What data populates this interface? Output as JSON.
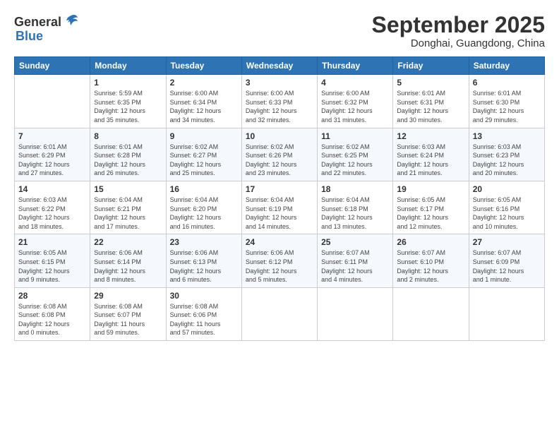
{
  "header": {
    "logo_general": "General",
    "logo_blue": "Blue",
    "month": "September 2025",
    "location": "Donghai, Guangdong, China"
  },
  "weekdays": [
    "Sunday",
    "Monday",
    "Tuesday",
    "Wednesday",
    "Thursday",
    "Friday",
    "Saturday"
  ],
  "weeks": [
    [
      {
        "day": "",
        "info": ""
      },
      {
        "day": "1",
        "info": "Sunrise: 5:59 AM\nSunset: 6:35 PM\nDaylight: 12 hours\nand 35 minutes."
      },
      {
        "day": "2",
        "info": "Sunrise: 6:00 AM\nSunset: 6:34 PM\nDaylight: 12 hours\nand 34 minutes."
      },
      {
        "day": "3",
        "info": "Sunrise: 6:00 AM\nSunset: 6:33 PM\nDaylight: 12 hours\nand 32 minutes."
      },
      {
        "day": "4",
        "info": "Sunrise: 6:00 AM\nSunset: 6:32 PM\nDaylight: 12 hours\nand 31 minutes."
      },
      {
        "day": "5",
        "info": "Sunrise: 6:01 AM\nSunset: 6:31 PM\nDaylight: 12 hours\nand 30 minutes."
      },
      {
        "day": "6",
        "info": "Sunrise: 6:01 AM\nSunset: 6:30 PM\nDaylight: 12 hours\nand 29 minutes."
      }
    ],
    [
      {
        "day": "7",
        "info": "Sunrise: 6:01 AM\nSunset: 6:29 PM\nDaylight: 12 hours\nand 27 minutes."
      },
      {
        "day": "8",
        "info": "Sunrise: 6:01 AM\nSunset: 6:28 PM\nDaylight: 12 hours\nand 26 minutes."
      },
      {
        "day": "9",
        "info": "Sunrise: 6:02 AM\nSunset: 6:27 PM\nDaylight: 12 hours\nand 25 minutes."
      },
      {
        "day": "10",
        "info": "Sunrise: 6:02 AM\nSunset: 6:26 PM\nDaylight: 12 hours\nand 23 minutes."
      },
      {
        "day": "11",
        "info": "Sunrise: 6:02 AM\nSunset: 6:25 PM\nDaylight: 12 hours\nand 22 minutes."
      },
      {
        "day": "12",
        "info": "Sunrise: 6:03 AM\nSunset: 6:24 PM\nDaylight: 12 hours\nand 21 minutes."
      },
      {
        "day": "13",
        "info": "Sunrise: 6:03 AM\nSunset: 6:23 PM\nDaylight: 12 hours\nand 20 minutes."
      }
    ],
    [
      {
        "day": "14",
        "info": "Sunrise: 6:03 AM\nSunset: 6:22 PM\nDaylight: 12 hours\nand 18 minutes."
      },
      {
        "day": "15",
        "info": "Sunrise: 6:04 AM\nSunset: 6:21 PM\nDaylight: 12 hours\nand 17 minutes."
      },
      {
        "day": "16",
        "info": "Sunrise: 6:04 AM\nSunset: 6:20 PM\nDaylight: 12 hours\nand 16 minutes."
      },
      {
        "day": "17",
        "info": "Sunrise: 6:04 AM\nSunset: 6:19 PM\nDaylight: 12 hours\nand 14 minutes."
      },
      {
        "day": "18",
        "info": "Sunrise: 6:04 AM\nSunset: 6:18 PM\nDaylight: 12 hours\nand 13 minutes."
      },
      {
        "day": "19",
        "info": "Sunrise: 6:05 AM\nSunset: 6:17 PM\nDaylight: 12 hours\nand 12 minutes."
      },
      {
        "day": "20",
        "info": "Sunrise: 6:05 AM\nSunset: 6:16 PM\nDaylight: 12 hours\nand 10 minutes."
      }
    ],
    [
      {
        "day": "21",
        "info": "Sunrise: 6:05 AM\nSunset: 6:15 PM\nDaylight: 12 hours\nand 9 minutes."
      },
      {
        "day": "22",
        "info": "Sunrise: 6:06 AM\nSunset: 6:14 PM\nDaylight: 12 hours\nand 8 minutes."
      },
      {
        "day": "23",
        "info": "Sunrise: 6:06 AM\nSunset: 6:13 PM\nDaylight: 12 hours\nand 6 minutes."
      },
      {
        "day": "24",
        "info": "Sunrise: 6:06 AM\nSunset: 6:12 PM\nDaylight: 12 hours\nand 5 minutes."
      },
      {
        "day": "25",
        "info": "Sunrise: 6:07 AM\nSunset: 6:11 PM\nDaylight: 12 hours\nand 4 minutes."
      },
      {
        "day": "26",
        "info": "Sunrise: 6:07 AM\nSunset: 6:10 PM\nDaylight: 12 hours\nand 2 minutes."
      },
      {
        "day": "27",
        "info": "Sunrise: 6:07 AM\nSunset: 6:09 PM\nDaylight: 12 hours\nand 1 minute."
      }
    ],
    [
      {
        "day": "28",
        "info": "Sunrise: 6:08 AM\nSunset: 6:08 PM\nDaylight: 12 hours\nand 0 minutes."
      },
      {
        "day": "29",
        "info": "Sunrise: 6:08 AM\nSunset: 6:07 PM\nDaylight: 11 hours\nand 59 minutes."
      },
      {
        "day": "30",
        "info": "Sunrise: 6:08 AM\nSunset: 6:06 PM\nDaylight: 11 hours\nand 57 minutes."
      },
      {
        "day": "",
        "info": ""
      },
      {
        "day": "",
        "info": ""
      },
      {
        "day": "",
        "info": ""
      },
      {
        "day": "",
        "info": ""
      }
    ]
  ]
}
